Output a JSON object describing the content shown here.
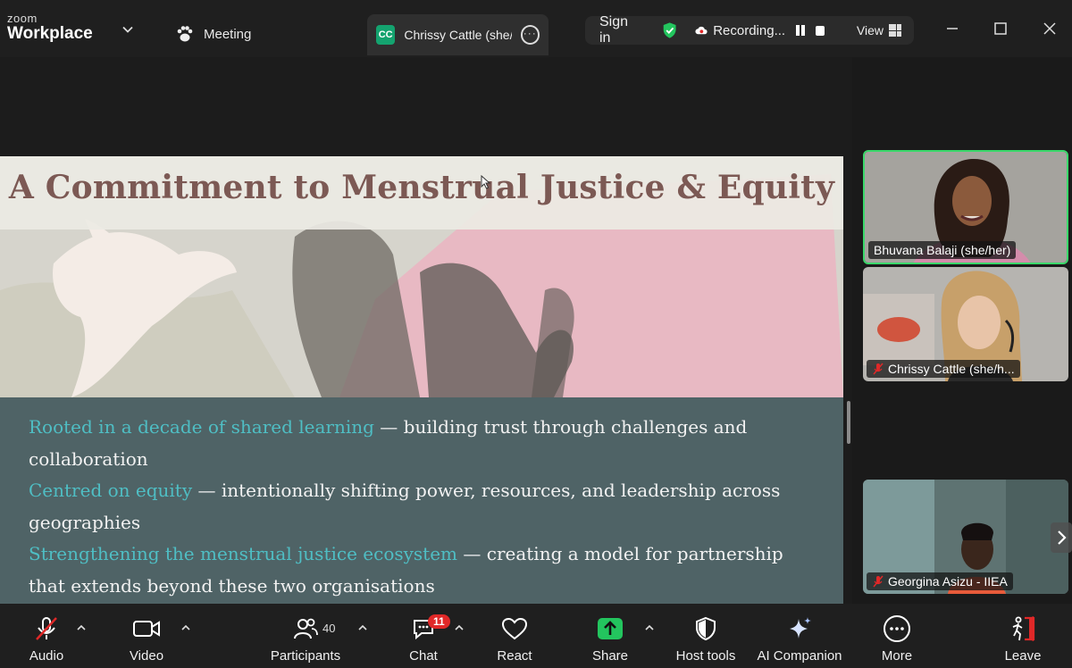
{
  "app": {
    "brand_small": "zoom",
    "brand_large": "Workplace"
  },
  "tabs": {
    "meeting": "Meeting",
    "active": {
      "initials": "CC",
      "label": "Chrissy Cattle (she/h"
    }
  },
  "header": {
    "sign_in": "Sign in",
    "recording": "Recording...",
    "view": "View"
  },
  "slide": {
    "title": "A Commitment to Menstrual Justice & Equity",
    "points": [
      {
        "highlight": "Rooted in a decade of shared learning",
        "text": " — building trust through challenges and collaboration"
      },
      {
        "highlight": "Centred on equity",
        "text": " — intentionally shifting power, resources, and leadership across geographies"
      },
      {
        "highlight": "Strengthening the menstrual justice ecosystem",
        "text": " — creating a model for partnership that extends beyond these two organisations"
      }
    ]
  },
  "participants_panel": [
    {
      "name": "Bhuvana Balaji (she/her)",
      "muted": false,
      "active_speaker": true
    },
    {
      "name": "Chrissy Cattle (she/h...",
      "muted": true,
      "active_speaker": false
    },
    {
      "name": "Georgina Asizu - IIEA",
      "muted": true,
      "active_speaker": false
    }
  ],
  "toolbar": {
    "audio": "Audio",
    "video": "Video",
    "participants": "Participants",
    "participants_count": "40",
    "chat": "Chat",
    "chat_badge": "11",
    "react": "React",
    "share": "Share",
    "host_tools": "Host tools",
    "ai_companion": "AI Companion",
    "more": "More",
    "leave": "Leave"
  },
  "colors": {
    "share_green": "#23c55e",
    "active_speaker_border": "#3ad86a",
    "muted_red": "#e02828",
    "slide_title": "#7c5954",
    "slide_highlight": "#4fbec4",
    "slide_panel": "#4f6366"
  }
}
